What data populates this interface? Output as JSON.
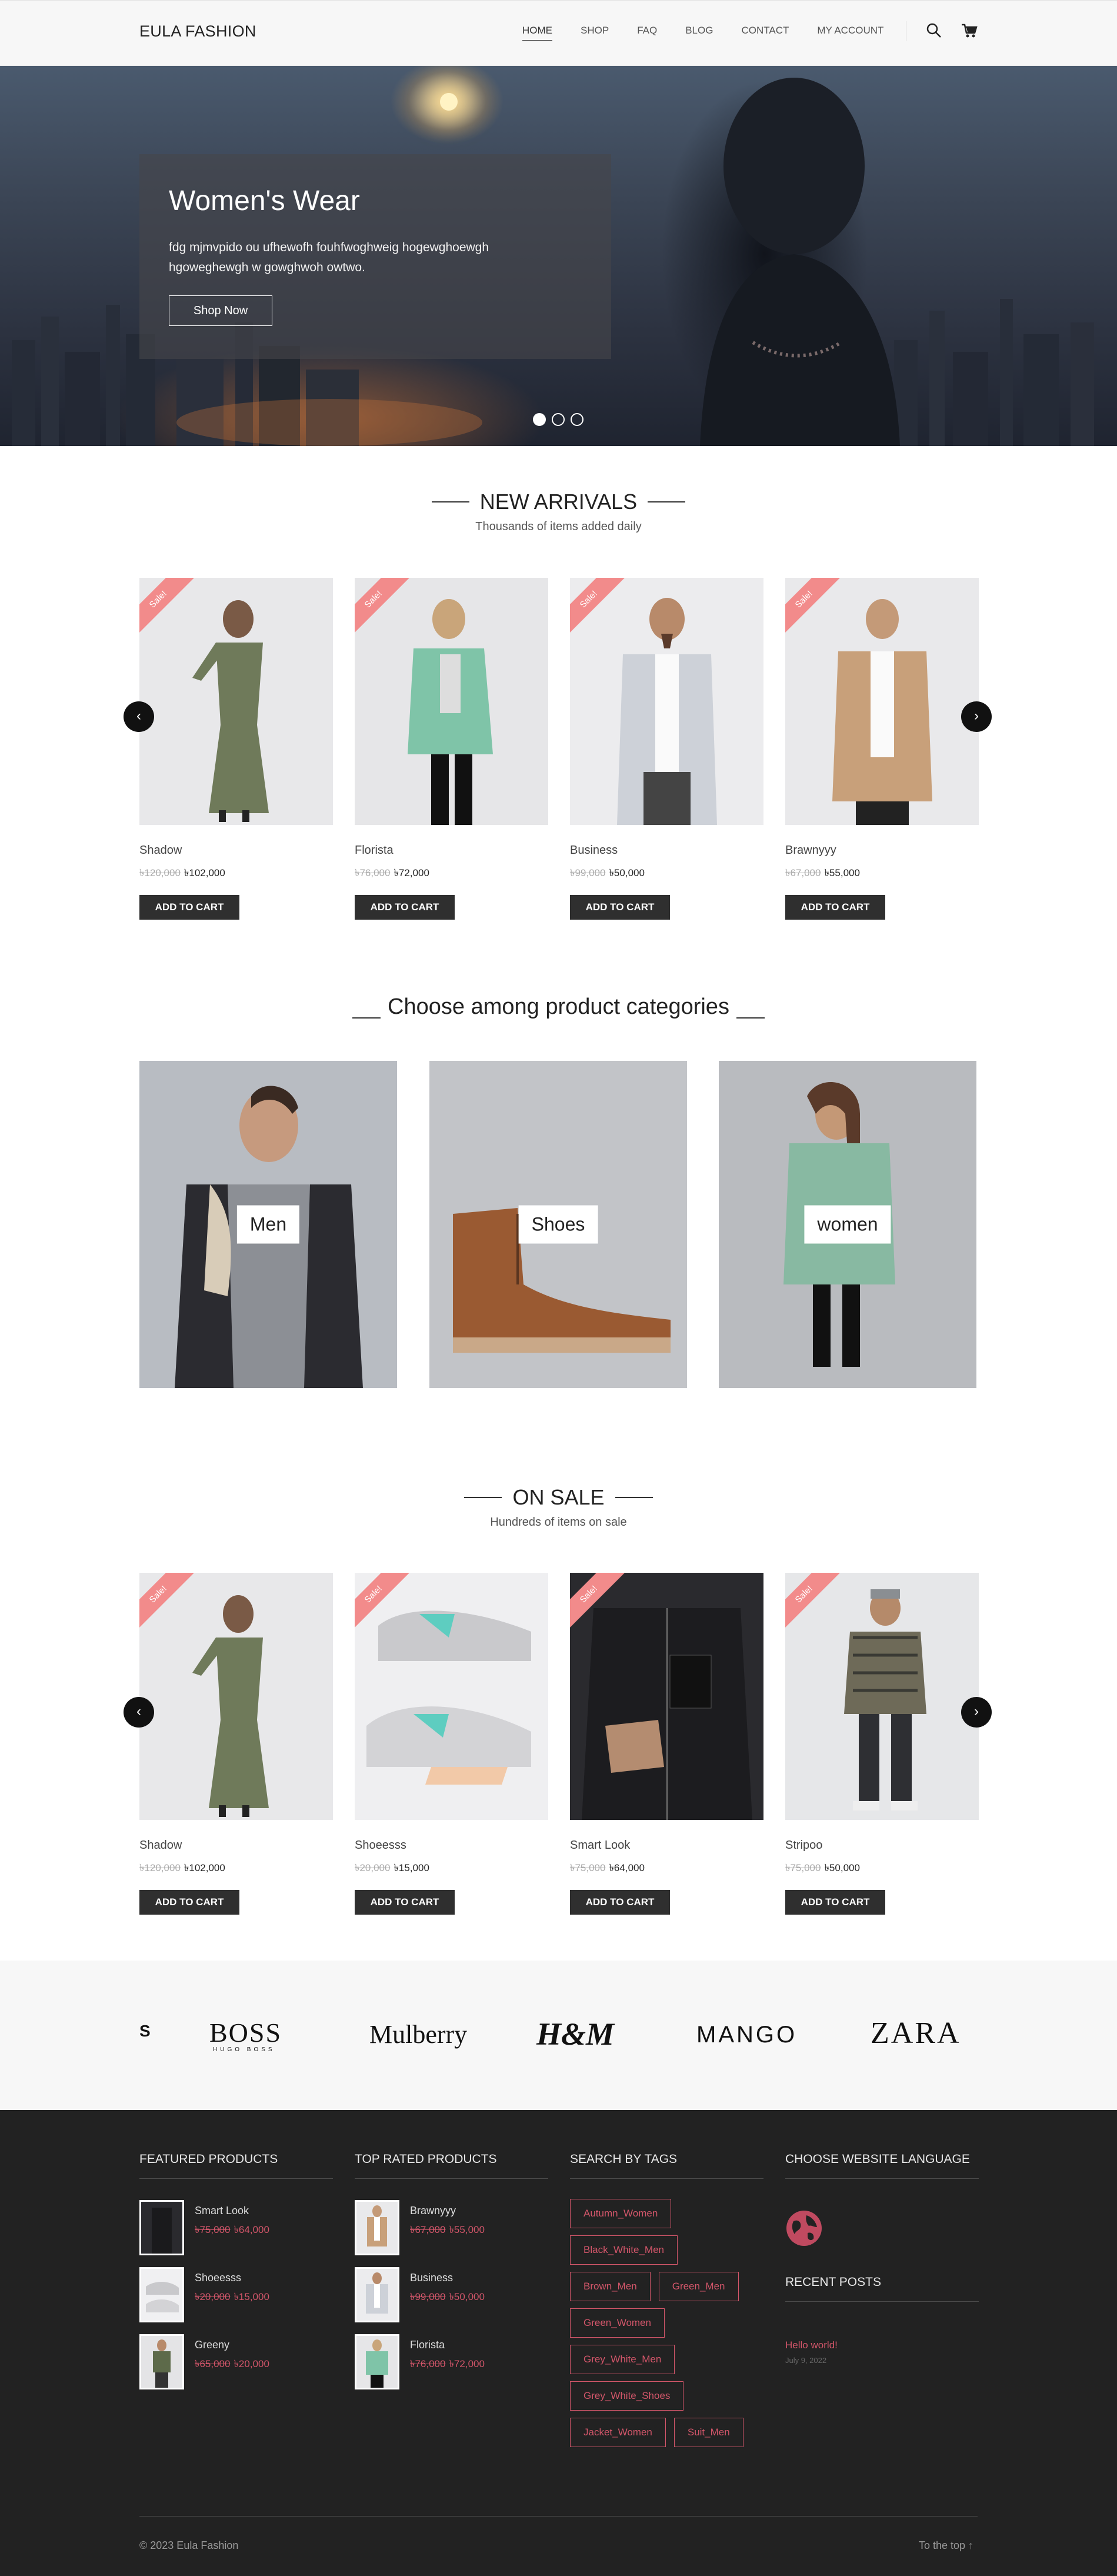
{
  "header": {
    "logo": "EULA FASHION",
    "nav": [
      {
        "label": "HOME",
        "active": true
      },
      {
        "label": "SHOP",
        "active": false
      },
      {
        "label": "FAQ",
        "active": false
      },
      {
        "label": "BLOG",
        "active": false
      },
      {
        "label": "CONTACT",
        "active": false
      },
      {
        "label": "MY ACCOUNT",
        "active": false
      }
    ],
    "icons": [
      "search-icon",
      "cart-icon"
    ]
  },
  "hero": {
    "title": "Women's Wear",
    "text": "fdg mjmvpido ou ufhewofh fouhfwoghweig hogewghoewgh hgoweghewgh w gowghwoh owtwo.",
    "button": "Shop Now",
    "slides": 3,
    "active_slide": 1
  },
  "new_arrivals": {
    "title": "NEW ARRIVALS",
    "subtitle": "Thousands of items added daily",
    "products": [
      {
        "name": "Shadow",
        "old_price": "৳120,000",
        "price": "৳102,000",
        "badge": "Sale!",
        "cta": "ADD TO CART"
      },
      {
        "name": "Florista",
        "old_price": "৳76,000",
        "price": "৳72,000",
        "badge": "Sale!",
        "cta": "ADD TO CART"
      },
      {
        "name": "Business",
        "old_price": "৳99,000",
        "price": "৳50,000",
        "badge": "Sale!",
        "cta": "ADD TO CART"
      },
      {
        "name": "Brawnyyy",
        "old_price": "৳67,000",
        "price": "৳55,000",
        "badge": "Sale!",
        "cta": "ADD TO CART"
      }
    ]
  },
  "categories": {
    "title": "Choose among product categories",
    "items": [
      {
        "label": "Men"
      },
      {
        "label": "Shoes"
      },
      {
        "label": "women"
      }
    ]
  },
  "on_sale": {
    "title": "ON SALE",
    "subtitle": "Hundreds of items on sale",
    "products": [
      {
        "name": "Shadow",
        "old_price": "৳120,000",
        "price": "৳102,000",
        "badge": "Sale!",
        "cta": "ADD TO CART"
      },
      {
        "name": "Shoeesss",
        "old_price": "৳20,000",
        "price": "৳15,000",
        "badge": "Sale!",
        "cta": "ADD TO CART"
      },
      {
        "name": "Smart Look",
        "old_price": "৳75,000",
        "price": "৳64,000",
        "badge": "Sale!",
        "cta": "ADD TO CART"
      },
      {
        "name": "Stripoo",
        "old_price": "৳75,000",
        "price": "৳50,000",
        "badge": "Sale!",
        "cta": "ADD TO CART"
      }
    ]
  },
  "brands": [
    "S",
    "BOSS",
    "HUGO BOSS",
    "Mulberry",
    "H&M",
    "MANGO",
    "ZARA"
  ],
  "footer": {
    "featured": {
      "title": "FEATURED PRODUCTS",
      "items": [
        {
          "name": "Smart Look",
          "old_price": "৳75,000",
          "price": "৳64,000"
        },
        {
          "name": "Shoeesss",
          "old_price": "৳20,000",
          "price": "৳15,000"
        },
        {
          "name": "Greeny",
          "old_price": "৳65,000",
          "price": "৳20,000"
        }
      ]
    },
    "top_rated": {
      "title": "TOP RATED PRODUCTS",
      "items": [
        {
          "name": "Brawnyyy",
          "old_price": "৳67,000",
          "price": "৳55,000"
        },
        {
          "name": "Business",
          "old_price": "৳99,000",
          "price": "৳50,000"
        },
        {
          "name": "Florista",
          "old_price": "৳76,000",
          "price": "৳72,000"
        }
      ]
    },
    "tags": {
      "title": "SEARCH BY TAGS",
      "items": [
        "Autumn_Women",
        "Black_White_Men",
        "Brown_Men",
        "Green_Men",
        "Green_Women",
        "Grey_White_Men",
        "Grey_White_Shoes",
        "Jacket_Women",
        "Suit_Men"
      ]
    },
    "language": {
      "title": "CHOOSE WEBSITE LANGUAGE",
      "icon": "globe-icon"
    },
    "recent_posts": {
      "title": "RECENT POSTS",
      "items": [
        {
          "title": "Hello world!",
          "date": "July 9, 2022"
        }
      ]
    },
    "copyright": "© 2023 Eula Fashion",
    "to_top": "To the top ↑"
  },
  "colors": {
    "accent": "#d3566a",
    "sale_ribbon": "#f28b8b",
    "footer_bg": "#222222",
    "button_bg": "#2f2f2f"
  }
}
